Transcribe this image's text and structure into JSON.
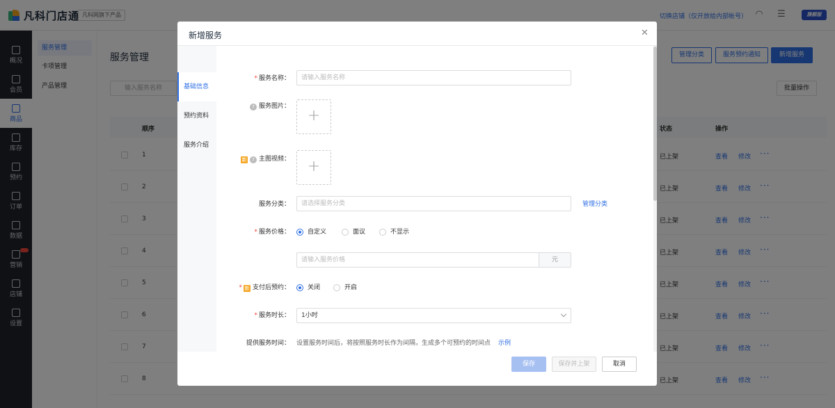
{
  "app": {
    "logo_text": "凡科门店通",
    "brand_tag": "凡科网旗下产品"
  },
  "topbar": {
    "switch_store": "切换店铺（仅开放给内部帐号）",
    "headset_icon": "headset-icon",
    "menu_icon": "menu-icon",
    "badge": "旗舰版"
  },
  "nav": {
    "items": [
      {
        "label": "概况",
        "icon": "grid-icon"
      },
      {
        "label": "会员",
        "icon": "member-icon"
      },
      {
        "label": "商品",
        "icon": "goods-icon"
      },
      {
        "label": "库存",
        "icon": "stock-icon"
      },
      {
        "label": "预约",
        "icon": "calendar-icon"
      },
      {
        "label": "订单",
        "icon": "order-icon"
      },
      {
        "label": "数据",
        "icon": "data-icon"
      },
      {
        "label": "营销",
        "icon": "marketing-icon"
      },
      {
        "label": "店铺",
        "icon": "store-icon"
      },
      {
        "label": "设置",
        "icon": "gear-icon"
      }
    ]
  },
  "subnav": {
    "items": [
      "服务管理",
      "卡项管理",
      "产品管理"
    ]
  },
  "main": {
    "title": "服务管理",
    "buttons": {
      "manage_category": "管理分类",
      "notify": "服务预约通知",
      "add": "新增服务"
    },
    "search_placeholder": "输入服务名称",
    "batch": "批量操作",
    "columns": {
      "order": "顺序",
      "status": "状态",
      "action": "操作"
    },
    "rows": [
      {
        "n": "1",
        "status": "已上架"
      },
      {
        "n": "2",
        "status": "已上架"
      },
      {
        "n": "3",
        "status": "已上架"
      },
      {
        "n": "4",
        "status": "已上架"
      },
      {
        "n": "5",
        "status": "已上架"
      },
      {
        "n": "6",
        "status": "已上架"
      },
      {
        "n": "7",
        "status": "已上架"
      },
      {
        "n": "8",
        "status": "已上架"
      }
    ],
    "row_actions": {
      "view": "查看",
      "edit": "修改",
      "more": "···"
    }
  },
  "modal": {
    "title": "新增服务",
    "tabs": [
      "基础信息",
      "预约资料",
      "服务介绍"
    ],
    "fields": {
      "name": {
        "label": "服务名称：",
        "placeholder": "请输入服务名称"
      },
      "image": {
        "label": "服务图片："
      },
      "video": {
        "label": "主图视频：",
        "tag": "新"
      },
      "category": {
        "label": "服务分类：",
        "placeholder": "请选择服务分类",
        "link": "管理分类"
      },
      "price": {
        "label": "服务价格：",
        "options": [
          "自定义",
          "面议",
          "不显示"
        ],
        "placeholder": "请输入服务价格",
        "suffix": "元"
      },
      "pay_book": {
        "label": "支付后预约：",
        "tag": "新",
        "options": [
          "关闭",
          "开启"
        ]
      },
      "duration": {
        "label": "服务时长：",
        "value": "1小时"
      },
      "time": {
        "label": "提供服务时间：",
        "hint": "设置服务时间后，将按照服务时长作为间隔，生成多个可预约的时间点",
        "link": "示例"
      }
    },
    "buttons": {
      "save": "保存",
      "save_list": "保存并上架",
      "cancel": "取消"
    },
    "close_icon": "close-icon",
    "plus": "+",
    "required": "*",
    "question": "?"
  }
}
